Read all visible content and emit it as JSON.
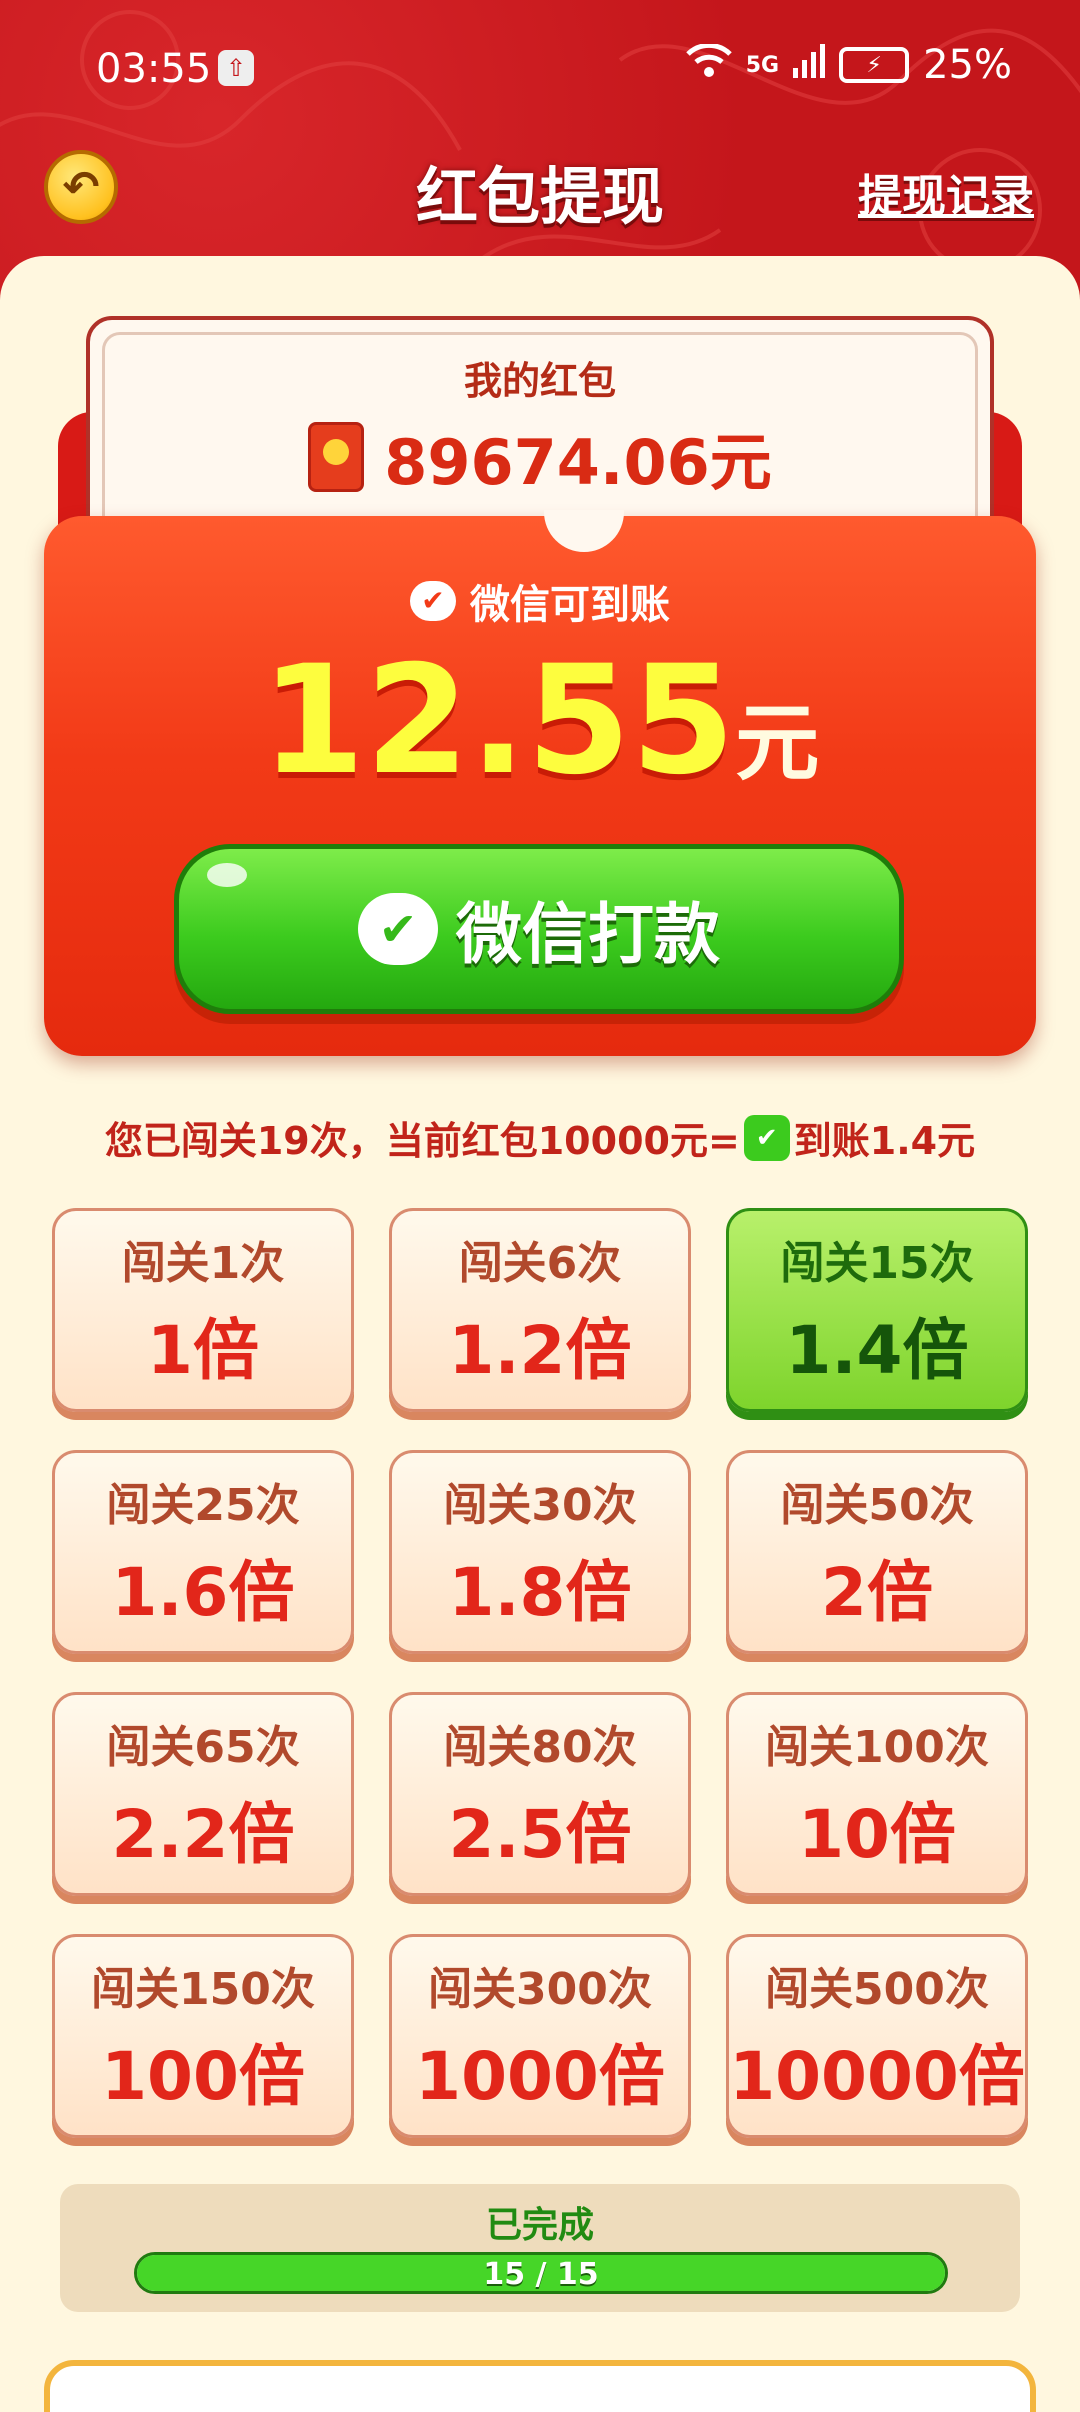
{
  "status_bar": {
    "time": "03:55",
    "network": "5G",
    "battery": "25%"
  },
  "header": {
    "title": "红包提现",
    "records_link": "提现记录"
  },
  "wallet": {
    "label": "我的红包",
    "balance": "89674.06元"
  },
  "withdraw": {
    "wechat_label": "微信可到账",
    "amount": "12.55",
    "unit": "元",
    "button_label": "微信打款"
  },
  "hint": {
    "text_before": "您已闯关19次，当前红包10000元=",
    "text_after": "到账1.4元"
  },
  "tiers": [
    {
      "levels": "闯关1次",
      "multiplier": "1倍",
      "active": false
    },
    {
      "levels": "闯关6次",
      "multiplier": "1.2倍",
      "active": false
    },
    {
      "levels": "闯关15次",
      "multiplier": "1.4倍",
      "active": true
    },
    {
      "levels": "闯关25次",
      "multiplier": "1.6倍",
      "active": false
    },
    {
      "levels": "闯关30次",
      "multiplier": "1.8倍",
      "active": false
    },
    {
      "levels": "闯关50次",
      "multiplier": "2倍",
      "active": false
    },
    {
      "levels": "闯关65次",
      "multiplier": "2.2倍",
      "active": false
    },
    {
      "levels": "闯关80次",
      "multiplier": "2.5倍",
      "active": false
    },
    {
      "levels": "闯关100次",
      "multiplier": "10倍",
      "active": false
    },
    {
      "levels": "闯关150次",
      "multiplier": "100倍",
      "active": false
    },
    {
      "levels": "闯关300次",
      "multiplier": "1000倍",
      "active": false
    },
    {
      "levels": "闯关500次",
      "multiplier": "10000倍",
      "active": false
    }
  ],
  "progress": {
    "status": "已完成",
    "text": "15 / 15",
    "value": 1.0
  },
  "colors": {
    "primary_red": "#c4161b",
    "panel_bg": "#fff7df",
    "wechat_green": "#3ccb1e",
    "amount_yellow": "#fdfd3e"
  }
}
